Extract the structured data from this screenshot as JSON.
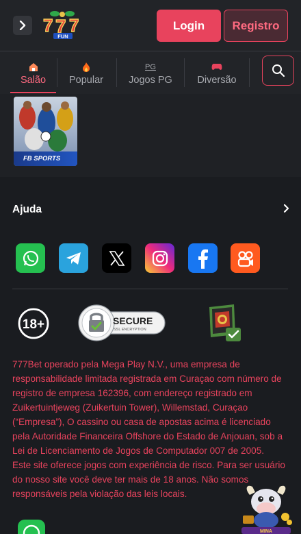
{
  "header": {
    "menu_icon": "chevron-right-icon",
    "logo_text": "FUN",
    "login_label": "Login",
    "register_label": "Registro"
  },
  "tabs": [
    {
      "label": "Salão",
      "icon": "home-icon",
      "active": true
    },
    {
      "label": "Popular",
      "icon": "fire-icon",
      "active": false
    },
    {
      "label": "Jogos PG",
      "icon": "pg-icon",
      "icon_text": "PG",
      "active": false
    },
    {
      "label": "Diversão",
      "icon": "gamepad-icon",
      "active": false
    }
  ],
  "search": {
    "icon": "search-icon"
  },
  "games": [
    {
      "label": "FB SPORTS"
    }
  ],
  "footer": {
    "help_label": "Ajuda",
    "socials": [
      {
        "name": "whatsapp",
        "color": "#25c050"
      },
      {
        "name": "telegram",
        "color": "#2aa3dd"
      },
      {
        "name": "x",
        "color": "#000000"
      },
      {
        "name": "instagram",
        "color": "#d6249f"
      },
      {
        "name": "facebook",
        "color": "#1877f2"
      },
      {
        "name": "kwai",
        "color": "#ff5a1f"
      }
    ],
    "badge_18": "18+",
    "secure_title": "SECURE",
    "secure_subtitle": "SSL ENCRYPTION",
    "legal_paragraph_1": "777Bet operado pela Mega Play N.V., uma empresa de responsabilidade limitada registrada em Curaçao com número de registro de empresa 162396, com endereço registrado em Zuikertuintjeweg (Zuikertuin Tower), Willemstad, Curaçao (“Empresa”), O cassino ou casa de apostas acima é licenciado pela Autoridade Financeira Offshore do Estado de Anjouan, sob a Lei de Licenciamento de Jogos de Computador 007 de 2005.",
    "legal_paragraph_2": "Este site oferece jogos com experiência de risco. Para ser usuário do nosso site você deve ter mais de 18 anos. Não somos responsáveis pela violação das leis locais.",
    "mascot_label": "MINA"
  },
  "colors": {
    "accent": "#e8435d",
    "background": "#1c1e22",
    "legal_text": "#e8435d"
  }
}
